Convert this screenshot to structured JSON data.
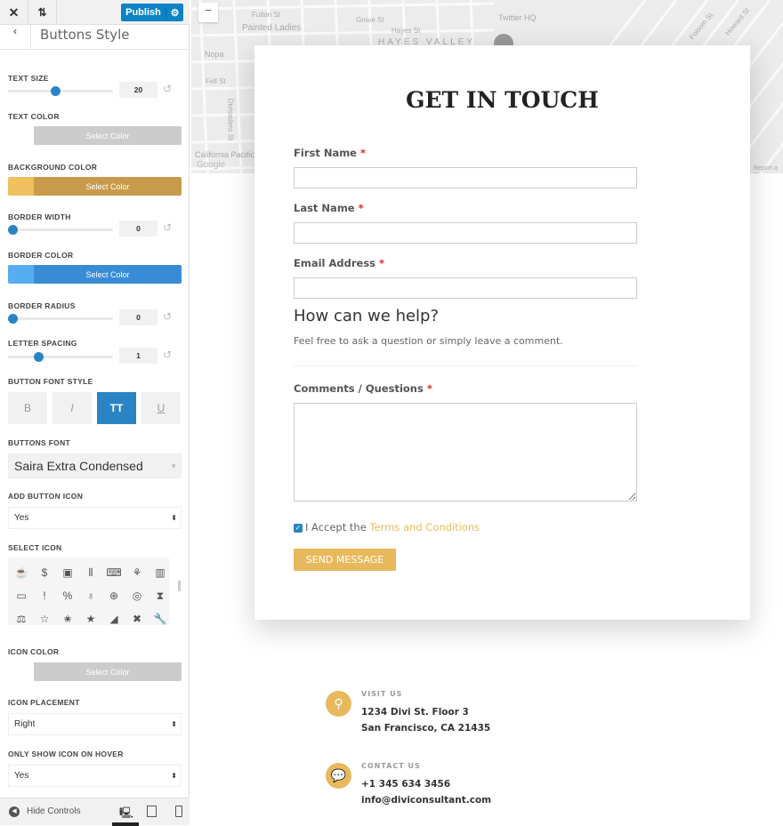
{
  "toolbar": {
    "close": "✕",
    "sort": "⇅",
    "publish": "Publish",
    "gear": "⚙"
  },
  "panel": {
    "title": "Buttons Style",
    "back": "‹"
  },
  "settings": {
    "text_size": {
      "label": "TEXT SIZE",
      "value": "20",
      "slider_fraction": 0.45
    },
    "text_color": {
      "label": "TEXT COLOR",
      "button": "Select Color",
      "swatch": "#ffffff",
      "bar": "#cccccc"
    },
    "background_color": {
      "label": "BACKGROUND COLOR",
      "button": "Select Color",
      "swatch": "#f0bf5e",
      "bar": "#c89a4c"
    },
    "border_width": {
      "label": "BORDER WIDTH",
      "value": "0",
      "slider_fraction": 0
    },
    "border_color": {
      "label": "BORDER COLOR",
      "button": "Select Color",
      "swatch": "#55aef2",
      "bar": "#3a8bd6"
    },
    "border_radius": {
      "label": "BORDER RADIUS",
      "value": "0",
      "slider_fraction": 0
    },
    "letter_spacing": {
      "label": "LETTER SPACING",
      "value": "1",
      "slider_fraction": 0.27
    },
    "font_style": {
      "label": "BUTTON FONT STYLE",
      "buttons": [
        "B",
        "I",
        "TT",
        "U"
      ],
      "active": "TT"
    },
    "buttons_font": {
      "label": "BUTTONS FONT",
      "value": "Saira Extra Condensed"
    },
    "add_icon": {
      "label": "ADD BUTTON ICON",
      "value": "Yes"
    },
    "select_icon": {
      "label": "SELECT ICON",
      "icons": [
        "☕",
        "$",
        "▣",
        "⫴",
        "⌨",
        "⚘",
        "▥",
        "▭",
        "!",
        "%",
        "♁",
        "⊕",
        "◎",
        "⧗",
        "⚖",
        "☆",
        "✬",
        "★",
        "◢",
        "✖",
        "🔧"
      ]
    },
    "icon_color": {
      "label": "ICON COLOR",
      "button": "Select Color",
      "swatch": "#ffffff",
      "bar": "#cccccc"
    },
    "icon_placement": {
      "label": "ICON PLACEMENT",
      "value": "Right"
    },
    "hover": {
      "label": "ONLY SHOW ICON ON HOVER",
      "value": "Yes"
    }
  },
  "bottom": {
    "hide": "Hide Controls"
  },
  "map": {
    "labels": [
      "Painted Ladies",
      "HAYES VALLEY",
      "Twitter HQ",
      "Nopa",
      "Fell St",
      "California Pacific",
      "Google",
      "Report a m",
      "Grove St",
      "Hayes St",
      "Howard St",
      "Folsom St",
      "Fulton St",
      "Divisadero St"
    ],
    "zoom_out": "−"
  },
  "form": {
    "title": "GET IN TOUCH",
    "first": "First Name",
    "last": "Last Name",
    "email": "Email Address",
    "required": "*",
    "help_title": "How can we help?",
    "help_text": "Feel free to ask a question or simply leave a comment.",
    "comments": "Comments / Questions",
    "accept": "I Accept the",
    "terms": "Terms and Conditions",
    "submit": "SEND MESSAGE",
    "accent": "#e8b95c"
  },
  "contact": {
    "visit_label": "VISIT US",
    "addr1": "1234 Divi St. Floor 3",
    "addr2": "San Francisco, CA 21435",
    "contact_label": "CONTACT US",
    "phone": "+1 345 634 3456",
    "email": "info@diviconsultant.com"
  }
}
